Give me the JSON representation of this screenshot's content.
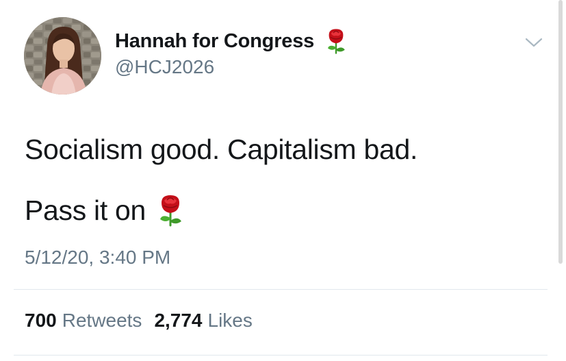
{
  "profile": {
    "display_name": "Hannah for Congress",
    "handle": "@HCJ2026",
    "name_emoji": "rose"
  },
  "tweet": {
    "line1": "Socialism good. Capitalism bad.",
    "line2": "Pass it on",
    "line2_emoji": "rose",
    "timestamp": "5/12/20, 3:40 PM"
  },
  "stats": {
    "retweets_count": "700",
    "retweets_label": "Retweets",
    "likes_count": "2,774",
    "likes_label": "Likes"
  },
  "colors": {
    "text": "#14171a",
    "secondary": "#657786",
    "divider": "#e1e8ed",
    "rose_red": "#d0121b",
    "rose_green": "#3f9a2a"
  },
  "icons": {
    "menu": "chevron-down-icon",
    "emoji": "rose-emoji-icon"
  }
}
